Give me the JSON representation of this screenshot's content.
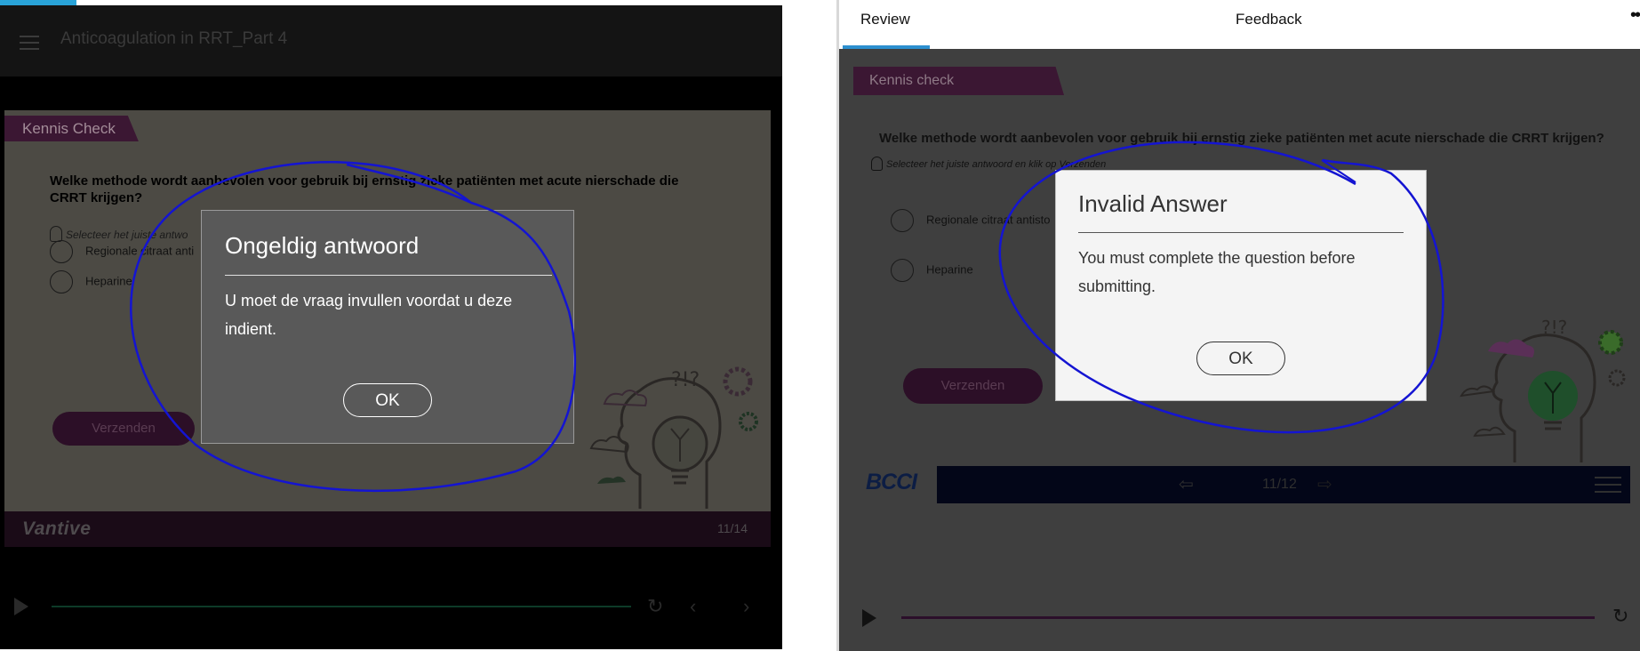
{
  "left": {
    "course_title": "Anticoagulation in RRT_Part 4",
    "tab_label": "Kennis Check",
    "question": "Welke methode wordt aanbevolen voor gebruik bij ernstig zieke patiënten met acute nierschade die CRRT krijgen?",
    "hint": "Selecteer het juiste antwo",
    "options": [
      "Regionale citraat anti",
      "Heparine"
    ],
    "submit_label": "Verzenden",
    "brand": "Vantive",
    "page_indicator": "11/14",
    "collapse_icon": "collapse-arrow-icon",
    "dialog": {
      "title": "Ongeldig antwoord",
      "message": "U moet de vraag invullen voordat u deze indient.",
      "ok_label": "OK"
    }
  },
  "right": {
    "tabs": {
      "review": "Review",
      "feedback": "Feedback",
      "more": "••"
    },
    "tab_label": "Kennis check",
    "question": "Welke methode wordt aanbevolen voor gebruik bij ernstig zieke patiënten met acute nierschade die CRRT krijgen?",
    "hint": "Selecteer het juiste antwoord en klik op Verzenden",
    "options": [
      "Regionale citraat antisto",
      "Heparine"
    ],
    "submit_label": "Verzenden",
    "brand": "BCCI",
    "page_indicator": "11/12",
    "dialog": {
      "title": "Invalid Answer",
      "message": "You must complete the question before submitting.",
      "ok_label": "OK"
    }
  },
  "colors": {
    "accent_blue": "#29a3d8",
    "annotation_ink": "#1414d2",
    "slide_purple": "#3b1733"
  }
}
